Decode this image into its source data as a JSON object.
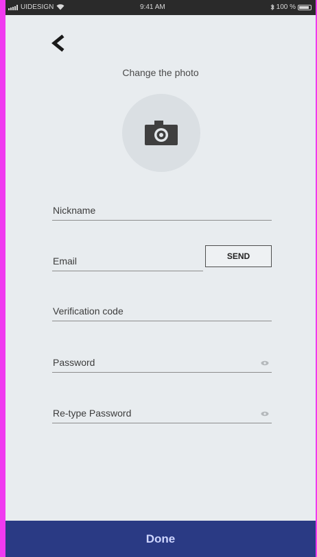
{
  "status_bar": {
    "carrier": "UIDESIGN",
    "time": "9:41 AM",
    "battery": "100 %"
  },
  "header": {
    "back_icon": "chevron-left-icon",
    "photo_label": "Change the photo",
    "photo_icon": "camera-icon"
  },
  "form": {
    "nickname_label": "Nickname",
    "email_label": "Email",
    "send_label": "SEND",
    "code_label": "Verification code",
    "password_label": "Password",
    "retype_label": "Re-type Password",
    "password_toggle_icon": "eye-icon"
  },
  "footer": {
    "done_label": "Done"
  },
  "colors": {
    "background": "#e8ecef",
    "done_bar": "#2a3a84",
    "status_bar": "#2a2a2a",
    "frame": "#f03af0"
  }
}
